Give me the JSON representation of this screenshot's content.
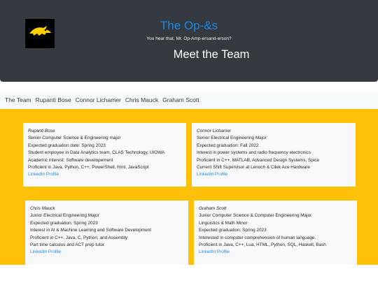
{
  "hero": {
    "title": "The Op-&s",
    "subtitle": "You hear that, Mr. Op-Amp-ersand-erson?",
    "heading": "Meet the Team",
    "logo_icon": "hawkeye-logo-icon",
    "title_color": "#1e88e5",
    "background": "#343a40"
  },
  "nav": {
    "items": [
      {
        "label": "The Team"
      },
      {
        "label": "Rupanti Bose"
      },
      {
        "label": "Connor Lichamer"
      },
      {
        "label": "Chris Mauck"
      },
      {
        "label": "Graham Scott"
      }
    ]
  },
  "band_color": "#ffc107",
  "cards": [
    {
      "name": "Rupanti Bose",
      "lines": [
        "Senior Computer Science & Engineering major",
        "Expected graduation date: Spring 2023",
        "Student employee in Data Analytics team, CLAS Technology, UIOWA",
        "Academic interest: Software developement",
        "Proficient in Java, Python, C++, PowerShell, html, JavaScript"
      ],
      "link": "LinkedIn Profile"
    },
    {
      "name": "Connor Lichamer",
      "lines": [
        "Senior Electrical Engineering Major",
        "Expected graduation: Fall 2022",
        "Interest in power systems and radio frequency electronics",
        "Proficient in C++, MATLAB, Advanced Design Systems, Spice",
        "Current Shift Supervisor at Lenoch & Cilek Ace Hardware"
      ],
      "link": "LinkedIn Profile"
    },
    {
      "name": "Chris Mauck",
      "lines": [
        "Junior Electrical Engineering Major",
        "Expected graduation: Spring 2023",
        "Interest in AI & Machine Learning and Software Development",
        "Proficient in C++, Java, C, Python, and Assembly",
        "Part time calculus and ACT prep tutor"
      ],
      "link": "LinkedIn Profile"
    },
    {
      "name": "Graham Scott",
      "lines": [
        "Junior Computer Science & Computer Engineering Major",
        "Linguistics & Math Minor",
        "Expected graduation: Spring 2023",
        "Interested in computer comprehension of human language.",
        "Proficient in Java, C++, Lua, HTML, Python, SQL, Haskell, Bash"
      ],
      "link": "LinkedIn Profile"
    }
  ]
}
